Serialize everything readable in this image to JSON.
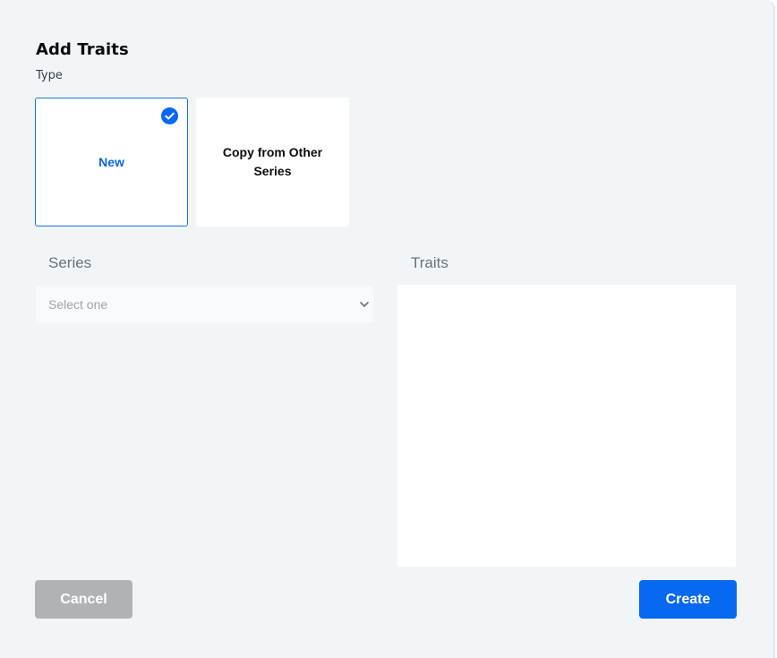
{
  "dialog": {
    "title": "Add Traits",
    "type_label": "Type"
  },
  "type_options": [
    {
      "label": "New",
      "selected": true
    },
    {
      "label": "Copy from Other Series",
      "selected": false
    }
  ],
  "series": {
    "label": "Series",
    "selected_value": "Select one"
  },
  "traits": {
    "label": "Traits"
  },
  "buttons": {
    "cancel_label": "Cancel",
    "create_label": "Create"
  },
  "colors": {
    "accent": "#0768f2",
    "selected_text": "#0a66e4",
    "cancel_bg": "#b0b3b6",
    "panel_bg": "#f2f5f8"
  },
  "icons": {
    "selected_check": "check-circle-icon",
    "select_caret": "chevron-down-icon"
  }
}
